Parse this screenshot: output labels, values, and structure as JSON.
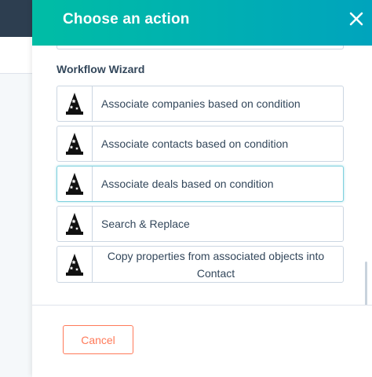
{
  "panel": {
    "title": "Choose an action",
    "close_icon": "close-icon",
    "accent_gradient": [
      "#00bda5",
      "#00a4bd"
    ]
  },
  "section": {
    "heading": "Workflow Wizard"
  },
  "actions": [
    {
      "label": "Associate companies based on condition",
      "icon": "wizard-hat-icon"
    },
    {
      "label": "Associate contacts based on condition",
      "icon": "wizard-hat-icon"
    },
    {
      "label": "Associate deals based on condition",
      "icon": "wizard-hat-icon"
    },
    {
      "label": "Search & Replace",
      "icon": "wizard-hat-icon"
    },
    {
      "label": "Copy properties from associated objects into Contact",
      "icon": "wizard-hat-icon"
    }
  ],
  "footer": {
    "cancel_label": "Cancel",
    "cancel_color": "#ff7a59"
  }
}
